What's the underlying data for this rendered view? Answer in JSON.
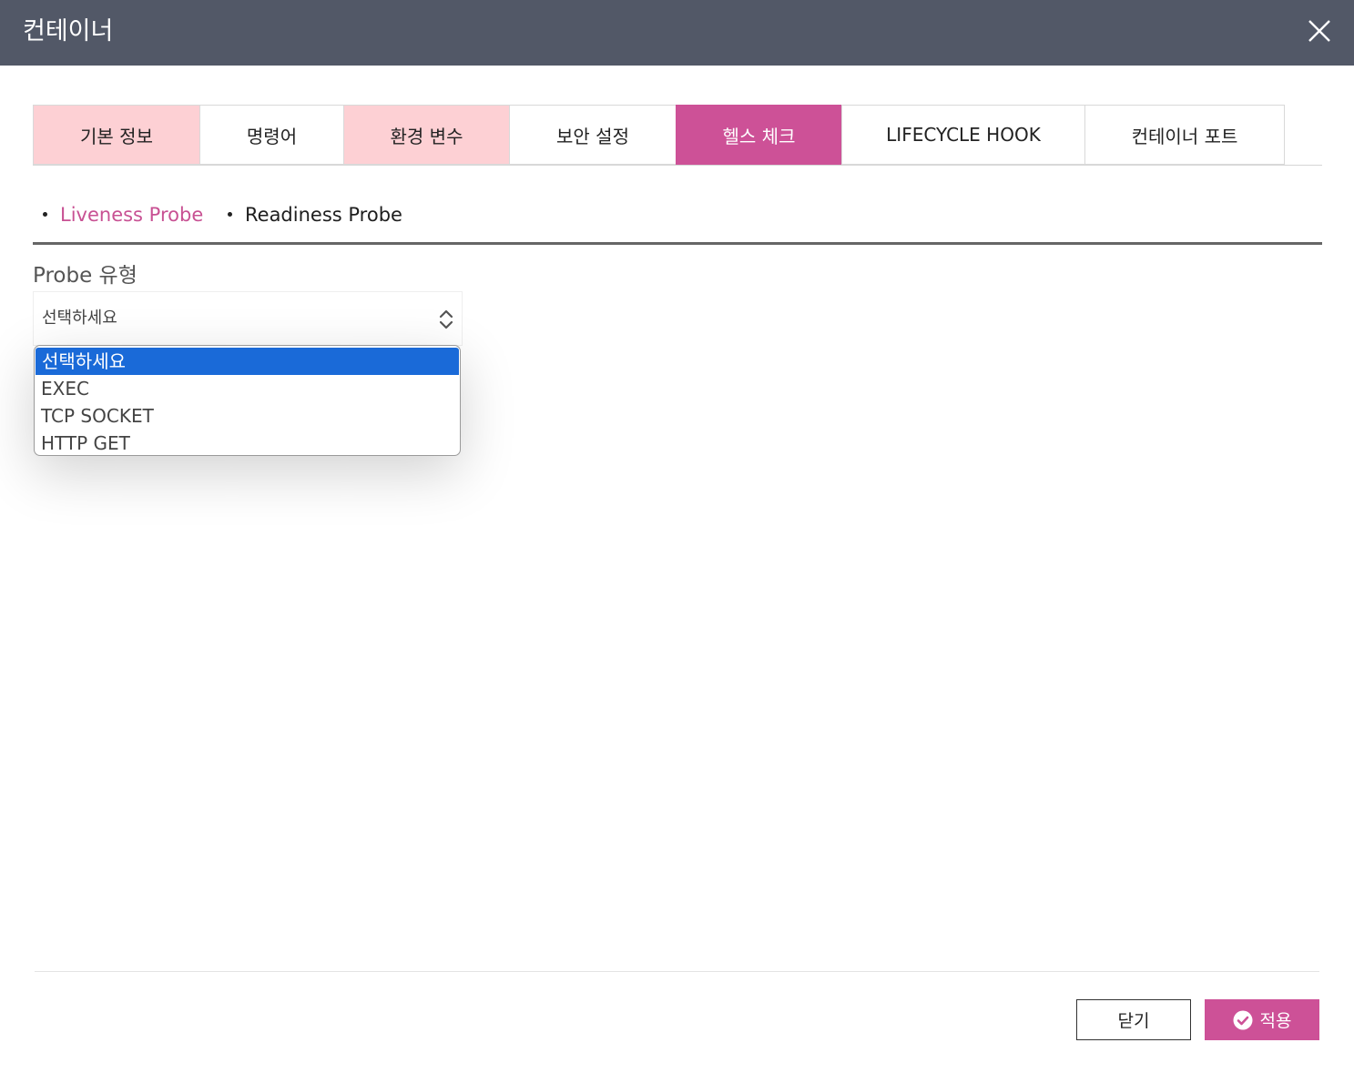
{
  "dialog": {
    "title": "컨테이너"
  },
  "tabs": [
    {
      "label": "기본 정보",
      "state": "visited"
    },
    {
      "label": "명령어",
      "state": "normal"
    },
    {
      "label": "환경 변수",
      "state": "visited"
    },
    {
      "label": "보안 설정",
      "state": "normal"
    },
    {
      "label": "헬스 체크",
      "state": "active"
    },
    {
      "label": "LIFECYCLE HOOK",
      "state": "normal"
    },
    {
      "label": "컨테이너 포트",
      "state": "normal"
    }
  ],
  "subtabs": [
    {
      "label": "Liveness Probe",
      "active": true
    },
    {
      "label": "Readiness Probe",
      "active": false
    }
  ],
  "probe_type": {
    "label": "Probe 유형",
    "value": "선택하세요",
    "options": [
      "선택하세요",
      "EXEC",
      "TCP SOCKET",
      "HTTP GET"
    ],
    "highlighted_index": 0
  },
  "footer": {
    "close_label": "닫기",
    "apply_label": "적용"
  },
  "colors": {
    "header_bg": "#525867",
    "accent": "#cd5197",
    "visited_tab": "#fdd0d4",
    "option_highlight": "#1a6ad8"
  },
  "icons": {
    "close": "close-icon",
    "select_arrows": "chevron-up-down-icon",
    "apply": "check-circle-icon"
  }
}
